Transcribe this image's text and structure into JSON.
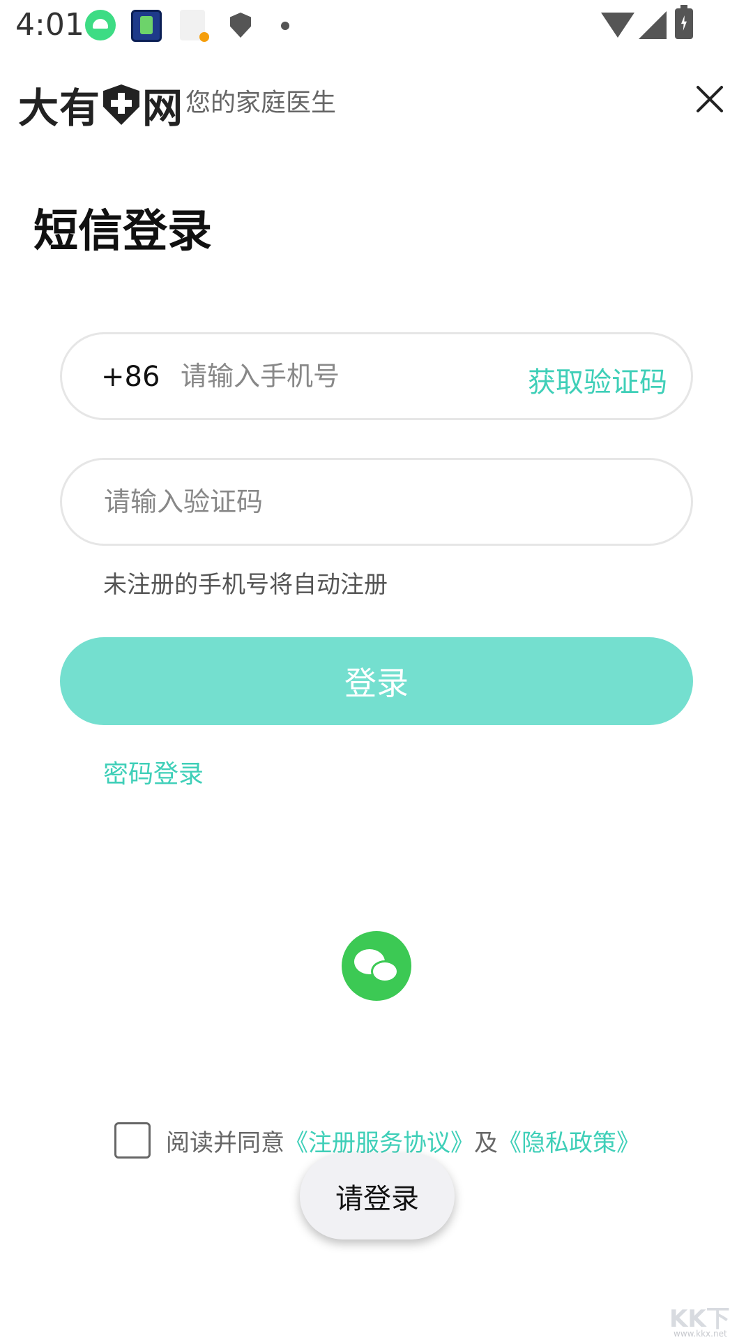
{
  "status_bar": {
    "time": "4:01",
    "icons": [
      "android-icon",
      "app-icon",
      "document-icon",
      "shield-icon",
      "dot-icon",
      "wifi-icon",
      "signal-icon",
      "battery-charging-icon"
    ]
  },
  "header": {
    "logo_part1": "大有",
    "logo_part2": "网",
    "tagline": "您的家庭医生"
  },
  "page_title": "短信登录",
  "phone_field": {
    "prefix": "+86",
    "placeholder": "请输入手机号",
    "value": "",
    "get_code_label": "获取验证码"
  },
  "code_field": {
    "placeholder": "请输入验证码",
    "value": ""
  },
  "hint": "未注册的手机号将自动注册",
  "login_button": "登录",
  "password_login": "密码登录",
  "agreement": {
    "checked": false,
    "text": "阅读并同意",
    "terms": "《注册服务协议》",
    "and": "及",
    "privacy": "《隐私政策》"
  },
  "toast": "请登录",
  "watermark": {
    "logo": "KK下载",
    "url": "www.kkx.net"
  },
  "colors": {
    "accent": "#3fcfb8",
    "button": "#74dfcf",
    "wechat": "#3cc954"
  }
}
